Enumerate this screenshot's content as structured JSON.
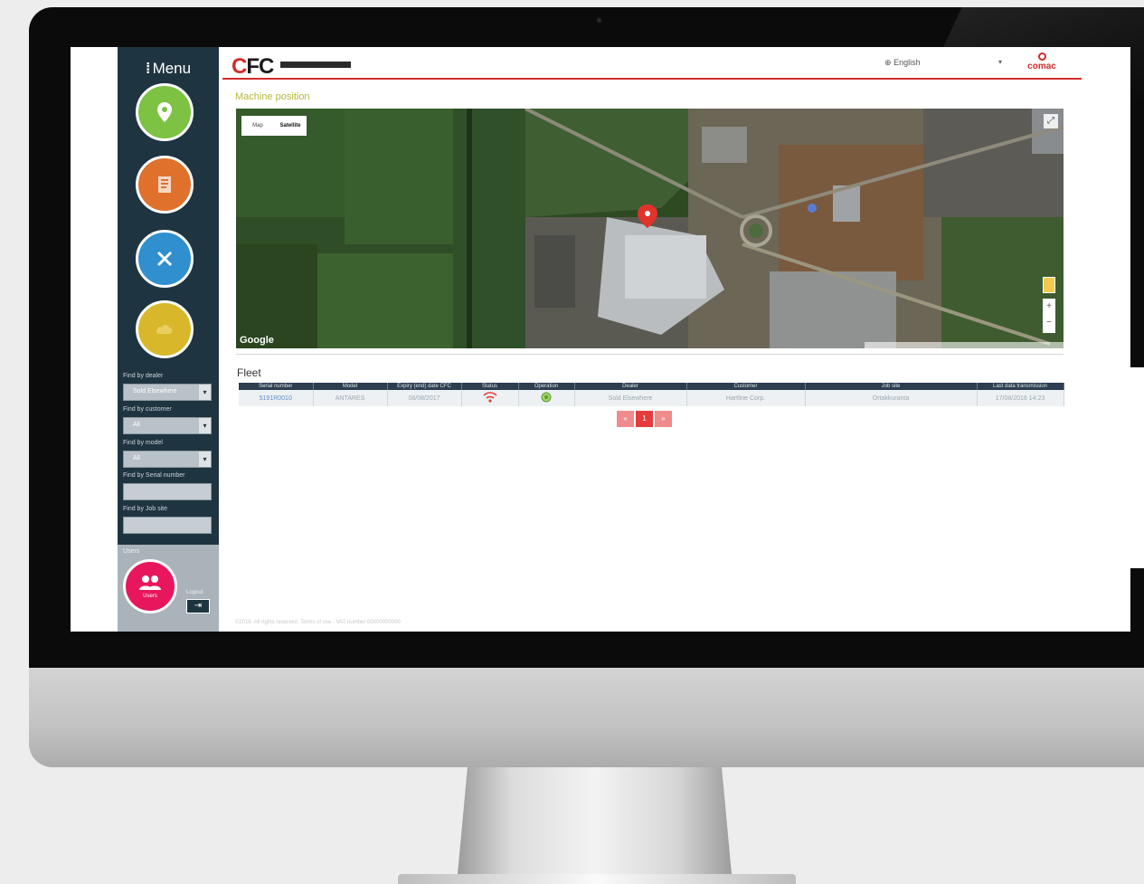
{
  "menu": {
    "title": "Menu"
  },
  "sidebar": {
    "buttons": [
      {
        "id": "map",
        "label": "Position",
        "color": "#7dc242",
        "icon": "map-pin-icon"
      },
      {
        "id": "docs",
        "label": "Documents",
        "color": "#e0712c",
        "icon": "document-icon"
      },
      {
        "id": "tools",
        "label": "Service",
        "color": "#2f8fcf",
        "icon": "wrench-icon"
      },
      {
        "id": "cloud",
        "label": "",
        "color": "#d8b82a",
        "icon": "cloud-icon"
      }
    ],
    "filters": {
      "dealer_label": "Find by dealer",
      "dealer_value": "Sold Elsewhere",
      "customer_label": "Find by customer",
      "customer_value": "All",
      "model_label": "Find by model",
      "model_value": "All",
      "serial_label": "Find by Serial number",
      "jobsite_label": "Find by Job site"
    },
    "users_label": "Users",
    "users_button": "Users",
    "logout_label": "Logout"
  },
  "header": {
    "logo_letters": "FC",
    "logo_c": "C",
    "language": "English",
    "brand": "comac"
  },
  "page": {
    "title": "Machine position"
  },
  "map": {
    "type_map": "Map",
    "type_satellite": "Satellite",
    "provider": "Google",
    "zoom_in": "+",
    "zoom_out": "−"
  },
  "fleet": {
    "title": "Fleet",
    "columns": [
      "Serial number",
      "Model",
      "Expiry (end) date CFC",
      "Status",
      "Operation",
      "Dealer",
      "Customer",
      "Job site",
      "Last data transmission"
    ],
    "rows": [
      [
        "5191R0010",
        "ANTARES",
        "08/08/2017",
        "",
        "",
        "Sold Elsewhere",
        "Hartline Corp.",
        "Ortakkuranta",
        "17/08/2016 14:23"
      ]
    ],
    "pages": [
      "«",
      "1",
      "»"
    ]
  },
  "footer": {
    "text": "©2016. All rights reserved. Terms of use - VAT number 00000000000"
  },
  "colors": {
    "accent": "#d42b2b",
    "sidebar": "#1f3441",
    "title_olive": "#b7b73a"
  }
}
